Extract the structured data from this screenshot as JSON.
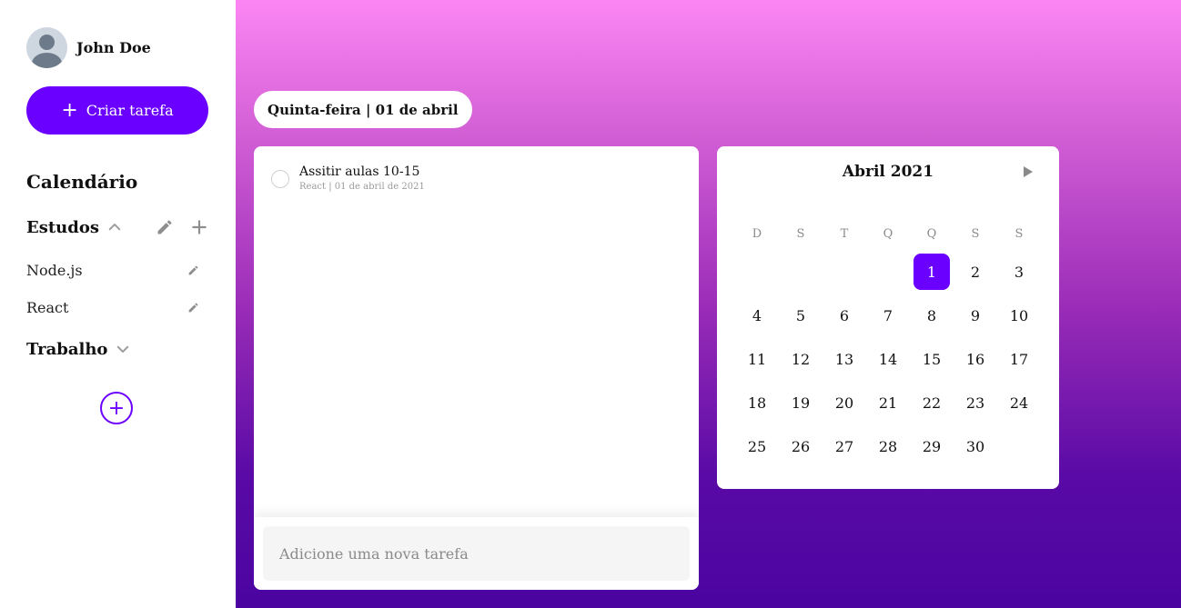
{
  "user": {
    "name": "John Doe"
  },
  "sidebar": {
    "create_label": "Criar tarefa",
    "section_title": "Calendário",
    "groups": [
      {
        "name": "Estudos",
        "expanded": true,
        "items": [
          "Node.js",
          "React"
        ]
      },
      {
        "name": "Trabalho",
        "expanded": false,
        "items": []
      }
    ]
  },
  "header": {
    "date_label": "Quinta-feira | 01 de abril"
  },
  "tasks": [
    {
      "title": "Assitir aulas 10-15",
      "meta": "React | 01 de abril de 2021",
      "done": false
    }
  ],
  "new_task": {
    "placeholder": "Adicione uma nova tarefa",
    "value": ""
  },
  "calendar": {
    "title": "Abril 2021",
    "weekdays": [
      "D",
      "S",
      "T",
      "Q",
      "Q",
      "S",
      "S"
    ],
    "weeks": [
      [
        "",
        "",
        "",
        "",
        "1",
        "2",
        "3"
      ],
      [
        "4",
        "5",
        "6",
        "7",
        "8",
        "9",
        "10"
      ],
      [
        "11",
        "12",
        "13",
        "14",
        "15",
        "16",
        "17"
      ],
      [
        "18",
        "19",
        "20",
        "21",
        "22",
        "23",
        "24"
      ],
      [
        "25",
        "26",
        "27",
        "28",
        "29",
        "30",
        ""
      ]
    ],
    "selected_day": "1"
  },
  "colors": {
    "accent": "#6a00ff",
    "gradient_top": "#fb86f3",
    "gradient_bottom": "#4b04a0"
  },
  "icons": {
    "avatar": "user-avatar-icon",
    "create": "plus-icon",
    "expand": "chevron-up-icon",
    "collapse": "chevron-down-icon",
    "edit": "pencil-icon",
    "add_item": "plus-icon",
    "add_group": "circle-plus-icon",
    "next_month": "triangle-right-icon"
  }
}
